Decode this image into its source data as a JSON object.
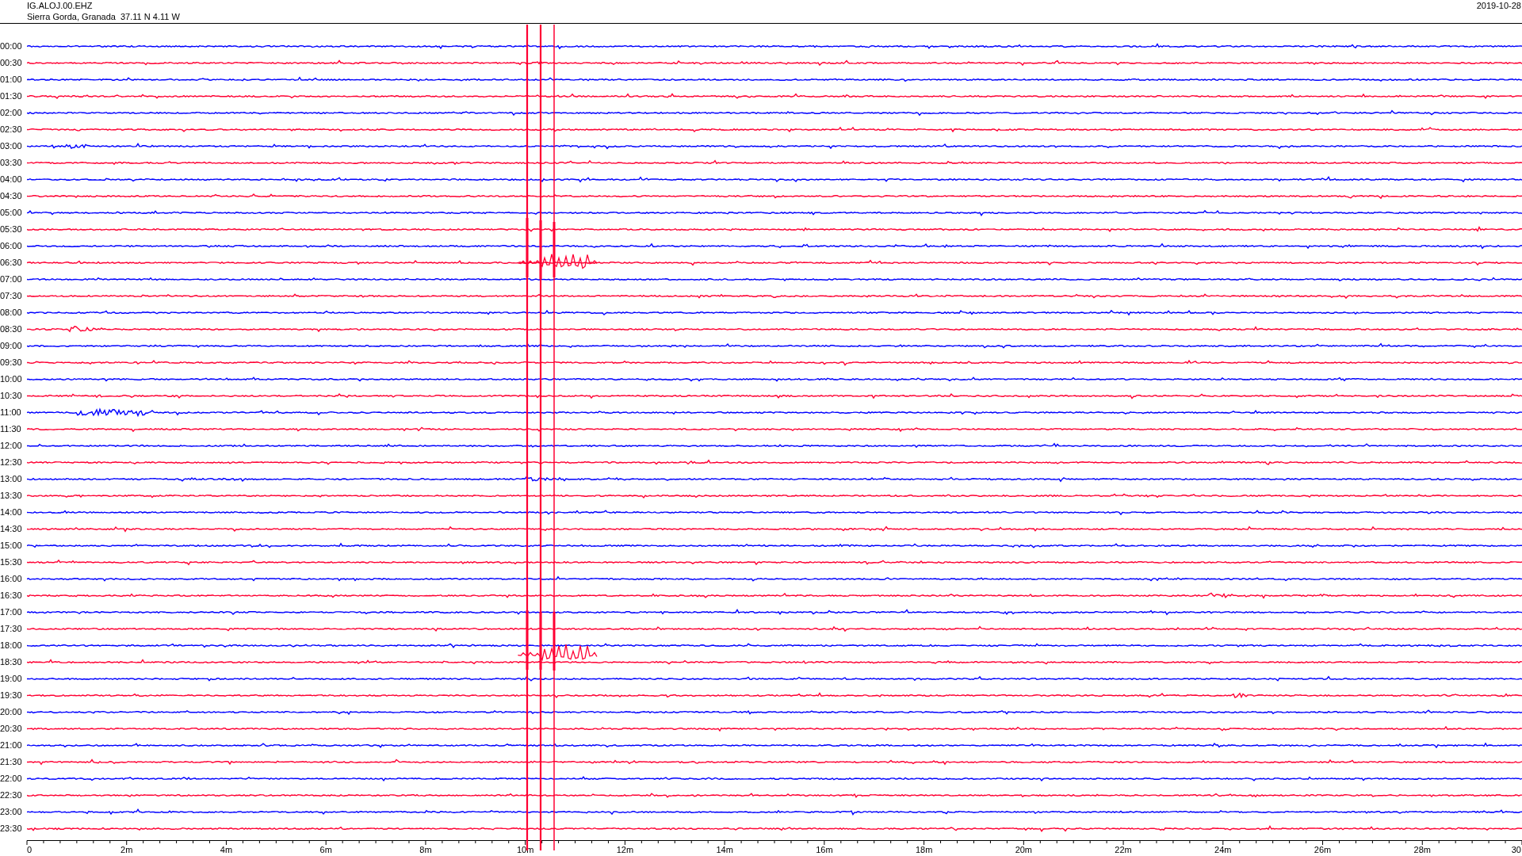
{
  "header": {
    "station": "IG.ALOJ.00.EHZ",
    "location": "Sierra Gorda, Granada  37.11 N 4.11 W",
    "date": "2019-10-28"
  },
  "rows": [
    {
      "label": "00:00",
      "color": "#0000ff"
    },
    {
      "label": "00:30",
      "color": "#ff0033"
    },
    {
      "label": "01:00",
      "color": "#0000ff"
    },
    {
      "label": "01:30",
      "color": "#ff0033"
    },
    {
      "label": "02:00",
      "color": "#0000ff"
    },
    {
      "label": "02:30",
      "color": "#ff0033"
    },
    {
      "label": "03:00",
      "color": "#0000ff"
    },
    {
      "label": "03:30",
      "color": "#ff0033"
    },
    {
      "label": "04:00",
      "color": "#0000ff"
    },
    {
      "label": "04:30",
      "color": "#ff0033"
    },
    {
      "label": "05:00",
      "color": "#0000ff"
    },
    {
      "label": "05:30",
      "color": "#ff0033"
    },
    {
      "label": "06:00",
      "color": "#0000ff"
    },
    {
      "label": "06:30",
      "color": "#ff0033"
    },
    {
      "label": "07:00",
      "color": "#0000ff"
    },
    {
      "label": "07:30",
      "color": "#ff0033"
    },
    {
      "label": "08:00",
      "color": "#0000ff"
    },
    {
      "label": "08:30",
      "color": "#ff0033"
    },
    {
      "label": "09:00",
      "color": "#0000ff"
    },
    {
      "label": "09:30",
      "color": "#ff0033"
    },
    {
      "label": "10:00",
      "color": "#0000ff"
    },
    {
      "label": "10:30",
      "color": "#ff0033"
    },
    {
      "label": "11:00",
      "color": "#0000ff"
    },
    {
      "label": "11:30",
      "color": "#ff0033"
    },
    {
      "label": "12:00",
      "color": "#0000ff"
    },
    {
      "label": "12:30",
      "color": "#ff0033"
    },
    {
      "label": "13:00",
      "color": "#0000ff"
    },
    {
      "label": "13:30",
      "color": "#ff0033"
    },
    {
      "label": "14:00",
      "color": "#0000ff"
    },
    {
      "label": "14:30",
      "color": "#ff0033"
    },
    {
      "label": "15:00",
      "color": "#0000ff"
    },
    {
      "label": "15:30",
      "color": "#ff0033"
    },
    {
      "label": "16:00",
      "color": "#0000ff"
    },
    {
      "label": "16:30",
      "color": "#ff0033"
    },
    {
      "label": "17:00",
      "color": "#0000ff"
    },
    {
      "label": "17:30",
      "color": "#ff0033"
    },
    {
      "label": "18:00",
      "color": "#0000ff"
    },
    {
      "label": "18:30",
      "color": "#ff0033"
    },
    {
      "label": "19:00",
      "color": "#0000ff"
    },
    {
      "label": "19:30",
      "color": "#ff0033"
    },
    {
      "label": "20:00",
      "color": "#0000ff"
    },
    {
      "label": "20:30",
      "color": "#ff0033"
    },
    {
      "label": "21:00",
      "color": "#0000ff"
    },
    {
      "label": "21:30",
      "color": "#ff0033"
    },
    {
      "label": "22:00",
      "color": "#0000ff"
    },
    {
      "label": "22:30",
      "color": "#ff0033"
    },
    {
      "label": "23:00",
      "color": "#0000ff"
    },
    {
      "label": "23:30",
      "color": "#ff0033"
    }
  ],
  "axis": {
    "labels": [
      "0",
      "2m",
      "4m",
      "6m",
      "8m",
      "10m",
      "12m",
      "14m",
      "16m",
      "18m",
      "20m",
      "22m",
      "24m",
      "26m",
      "28m",
      "30"
    ]
  }
}
